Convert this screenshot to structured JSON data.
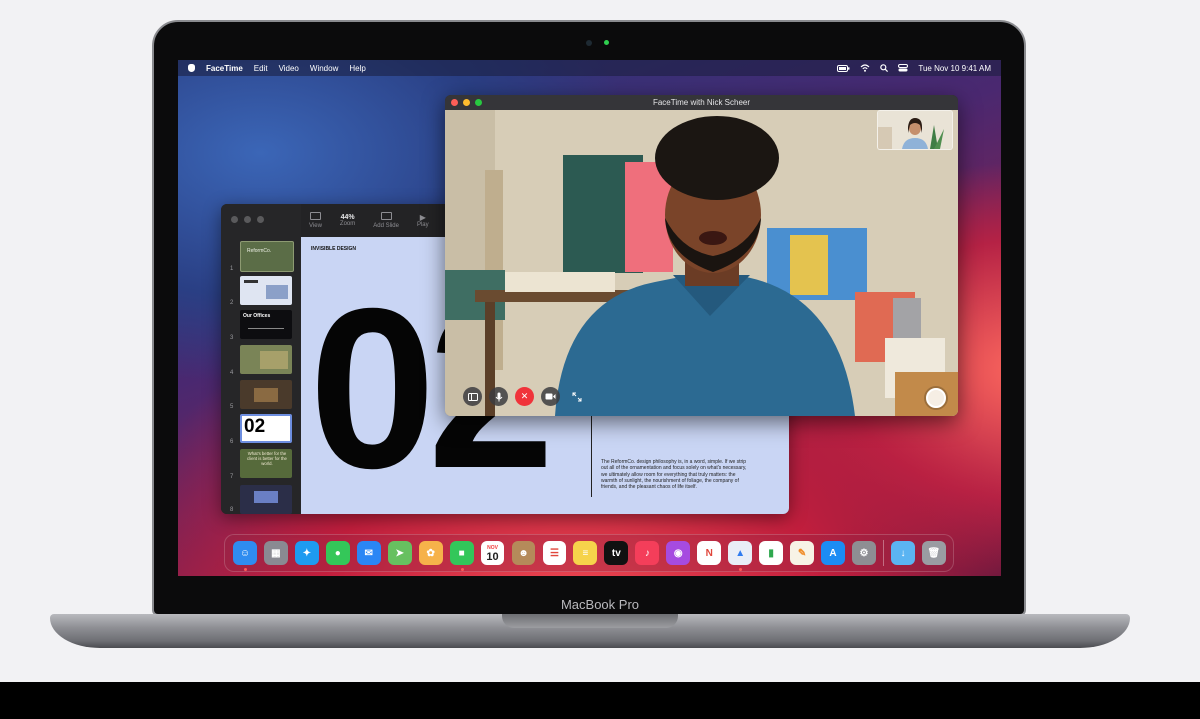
{
  "device": {
    "label": "MacBook Pro"
  },
  "menubar": {
    "app_name": "FaceTime",
    "items": [
      "Edit",
      "Video",
      "Window",
      "Help"
    ],
    "clock": "Tue Nov 10  9:41 AM"
  },
  "facetime": {
    "title": "FaceTime with Nick Scheer",
    "controls": [
      "sidebar-icon",
      "mute-mic-icon",
      "end-call-icon",
      "camera-icon",
      "fullscreen-icon"
    ]
  },
  "keynote": {
    "toolbar": {
      "view_label": "View",
      "zoom_value": "44%",
      "zoom_label": "Zoom",
      "add_slide_label": "Add Slide",
      "play_label": "Play"
    },
    "thumbnails": [
      {
        "num": "1",
        "text": "ReformCo.",
        "bg": "#5b6d47"
      },
      {
        "num": "2",
        "text": "",
        "bg": "#dfe5f2"
      },
      {
        "num": "3",
        "text": "Our Offices",
        "bg": "#0d0d10"
      },
      {
        "num": "4",
        "text": "",
        "bg": "#7a8457"
      },
      {
        "num": "5",
        "text": "",
        "bg": "#4a3a2b"
      },
      {
        "num": "6",
        "text": "02",
        "bg": "#ffffff"
      },
      {
        "num": "7",
        "text": "What's better for the client is better for the world.",
        "bg": "#566a3b"
      },
      {
        "num": "8",
        "text": "",
        "bg": "#2b2e48"
      }
    ],
    "slide": {
      "caption": "INVISIBLE DESIGN",
      "number": "02",
      "paragraph": "The ReformCo. design philosophy is, in a word, simple. If we strip out all of the ornamentation and focus solely on what's necessary, we ultimately allow room for everything that truly matters: the warmth of sunlight, the nourishment of foliage, the company of friends, and the pleasant chaos of life itself."
    }
  },
  "dock": {
    "calendar_month": "NOV",
    "calendar_day": "10",
    "apps": [
      {
        "name": "finder-icon",
        "color": "#2f8cf0",
        "running": true
      },
      {
        "name": "launchpad-icon",
        "color": "#8a8a92",
        "running": false
      },
      {
        "name": "safari-icon",
        "color": "#1e9bf0",
        "running": false
      },
      {
        "name": "messages-icon",
        "color": "#34c759",
        "running": false
      },
      {
        "name": "mail-icon",
        "color": "#2a86f5",
        "running": false
      },
      {
        "name": "maps-icon",
        "color": "#67c060",
        "running": false
      },
      {
        "name": "photos-icon",
        "color": "#f6b24a",
        "running": false
      },
      {
        "name": "facetime-icon",
        "color": "#33c75a",
        "running": true
      },
      {
        "name": "calendar-icon",
        "color": "#ffffff",
        "running": false
      },
      {
        "name": "contacts-icon",
        "color": "#b58a5a",
        "running": false
      },
      {
        "name": "reminders-icon",
        "color": "#ffffff",
        "running": false
      },
      {
        "name": "notes-icon",
        "color": "#f6d34b",
        "running": false
      },
      {
        "name": "apple-tv-icon",
        "color": "#111111",
        "running": false
      },
      {
        "name": "music-icon",
        "color": "#f43e5a",
        "running": false
      },
      {
        "name": "podcasts-icon",
        "color": "#a64be0",
        "running": false
      },
      {
        "name": "news-icon",
        "color": "#ffffff",
        "running": false
      },
      {
        "name": "keynote-icon",
        "color": "#e9eef7",
        "running": true
      },
      {
        "name": "numbers-icon",
        "color": "#ffffff",
        "running": false
      },
      {
        "name": "pages-icon",
        "color": "#f7f3e6",
        "running": false
      },
      {
        "name": "app-store-icon",
        "color": "#1c8cf4",
        "running": false
      },
      {
        "name": "system-preferences-icon",
        "color": "#8e8e93",
        "running": false
      }
    ],
    "trailing": [
      {
        "name": "downloads-folder-icon",
        "color": "#5bb4f2"
      },
      {
        "name": "trash-icon",
        "color": "#9a9ca2"
      }
    ]
  }
}
